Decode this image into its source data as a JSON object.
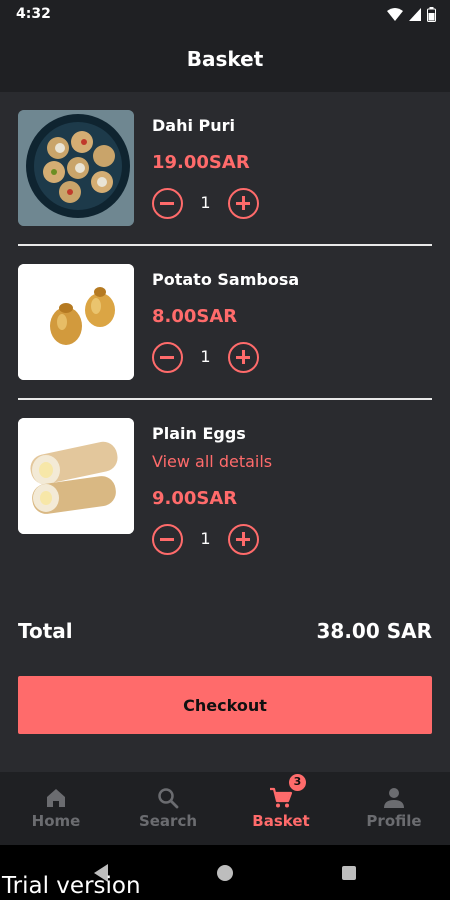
{
  "status_bar": {
    "time": "4:32"
  },
  "header": {
    "title": "Basket"
  },
  "items": [
    {
      "name": "Dahi Puri",
      "price": "19.00SAR",
      "quantity": "1",
      "image": "dahi-puri-photo"
    },
    {
      "name": "Potato Sambosa",
      "price": "8.00SAR",
      "quantity": "1",
      "image": "sambosa-photo"
    },
    {
      "name": "Plain Eggs",
      "link": "View all details",
      "price": "9.00SAR",
      "quantity": "1",
      "image": "egg-wrap-photo"
    }
  ],
  "total": {
    "label": "Total",
    "value": "38.00 SAR"
  },
  "checkout": {
    "label": "Checkout"
  },
  "nav": {
    "items": [
      {
        "label": "Home",
        "icon": "home-icon"
      },
      {
        "label": "Search",
        "icon": "search-icon"
      },
      {
        "label": "Basket",
        "icon": "cart-icon",
        "badge": "3"
      },
      {
        "label": "Profile",
        "icon": "person-icon"
      }
    ],
    "active": "Basket"
  },
  "watermark": "Trial version",
  "colors": {
    "accent": "#ff6b6b",
    "background": "#2a2b2f",
    "bar": "#1f2023"
  }
}
